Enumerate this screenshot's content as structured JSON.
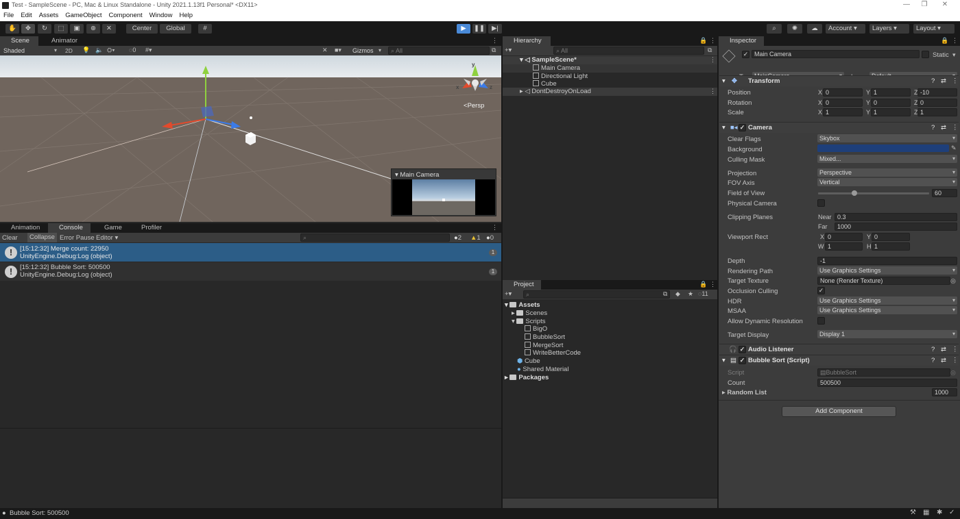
{
  "window": {
    "title": "Test - SampleScene - PC, Mac & Linux Standalone - Unity 2021.1.13f1 Personal* <DX11>",
    "minimize": "—",
    "restore": "❐",
    "close": "✕"
  },
  "menu": [
    "File",
    "Edit",
    "Assets",
    "GameObject",
    "Component",
    "Window",
    "Help"
  ],
  "toolbar": {
    "pivot": "Center",
    "space": "Global",
    "account": "Account",
    "layers": "Layers",
    "layout": "Layout"
  },
  "scene_tabs": {
    "scene": "Scene",
    "animator": "Animator",
    "shading": "Shaded",
    "mode_2d": "2D",
    "hidden_count": "0",
    "gizmos": "Gizmos",
    "search_placeholder": "All",
    "persp": "Persp",
    "camera_preview_title": "Main Camera"
  },
  "console": {
    "tabs": [
      "Animation",
      "Console",
      "Game",
      "Profiler"
    ],
    "clear": "Clear",
    "collapse": "Collapse",
    "error_pause": "Error Pause",
    "editor": "Editor",
    "count_info": "2",
    "count_warn": "1",
    "count_error": "0",
    "logs": [
      {
        "line1": "[15:12:32] Merge count: 22950",
        "line2": "UnityEngine.Debug:Log (object)",
        "count": "1"
      },
      {
        "line1": "[15:12:32] Bubble Sort: 500500",
        "line2": "UnityEngine.Debug:Log (object)",
        "count": "1"
      }
    ]
  },
  "hierarchy": {
    "tab": "Hierarchy",
    "search_placeholder": "All",
    "scene": "SampleScene*",
    "items": [
      "Main Camera",
      "Directional Light",
      "Cube"
    ],
    "ddol": "DontDestroyOnLoad"
  },
  "project": {
    "tab": "Project",
    "hidden_count": "11",
    "assets": "Assets",
    "scenes": "Scenes",
    "scripts": "Scripts",
    "script_items": [
      "BigO",
      "BubbleSort",
      "MergeSort",
      "WriteBetterCode"
    ],
    "cube": "Cube",
    "shared_material": "Shared Material",
    "packages": "Packages"
  },
  "inspector": {
    "tab": "Inspector",
    "object_name": "Main Camera",
    "static_label": "Static",
    "tag_label": "Tag",
    "tag_value": "MainCamera",
    "layer_label": "Layer",
    "layer_value": "Default",
    "transform": {
      "title": "Transform",
      "position_label": "Position",
      "rotation_label": "Rotation",
      "scale_label": "Scale",
      "position": [
        "0",
        "1",
        "-10"
      ],
      "rotation": [
        "0",
        "0",
        "0"
      ],
      "scale": [
        "1",
        "1",
        "1"
      ]
    },
    "axis": [
      "X",
      "Y",
      "Z"
    ],
    "camera": {
      "title": "Camera",
      "clear_flags_label": "Clear Flags",
      "clear_flags": "Skybox",
      "background_label": "Background",
      "background_color": "#1e3f7a",
      "culling_mask_label": "Culling Mask",
      "culling_mask": "Mixed...",
      "projection_label": "Projection",
      "projection": "Perspective",
      "fov_axis_label": "FOV Axis",
      "fov_axis": "Vertical",
      "fov_label": "Field of View",
      "fov": "60",
      "fov_fraction": 0.33,
      "physical_label": "Physical Camera",
      "clipping_label": "Clipping Planes",
      "near_label": "Near",
      "near": "0.3",
      "far_label": "Far",
      "far": "1000",
      "viewport_label": "Viewport Rect",
      "vp_x_label": "X",
      "vp_x": "0",
      "vp_y_label": "Y",
      "vp_y": "0",
      "vp_w_label": "W",
      "vp_w": "1",
      "vp_h_label": "H",
      "vp_h": "1",
      "depth_label": "Depth",
      "depth": "-1",
      "rendering_path_label": "Rendering Path",
      "rendering_path": "Use Graphics Settings",
      "target_texture_label": "Target Texture",
      "target_texture": "None (Render Texture)",
      "occlusion_label": "Occlusion Culling",
      "hdr_label": "HDR",
      "hdr": "Use Graphics Settings",
      "msaa_label": "MSAA",
      "msaa": "Use Graphics Settings",
      "dyn_res_label": "Allow Dynamic Resolution",
      "target_display_label": "Target Display",
      "target_display": "Display 1"
    },
    "audio_listener": "Audio Listener",
    "bubble_sort": {
      "title": "Bubble Sort (Script)",
      "script_label": "Script",
      "script_value": "BubbleSort",
      "count_label": "Count",
      "count": "500500",
      "random_list_label": "Random List",
      "random_list": "1000"
    },
    "add_component": "Add Component"
  },
  "status_bar": "Bubble Sort: 500500",
  "colors": {
    "selection": "#2c5d87",
    "play_accent": "#4a8ad8",
    "link_blue": "#7ab6f5"
  }
}
